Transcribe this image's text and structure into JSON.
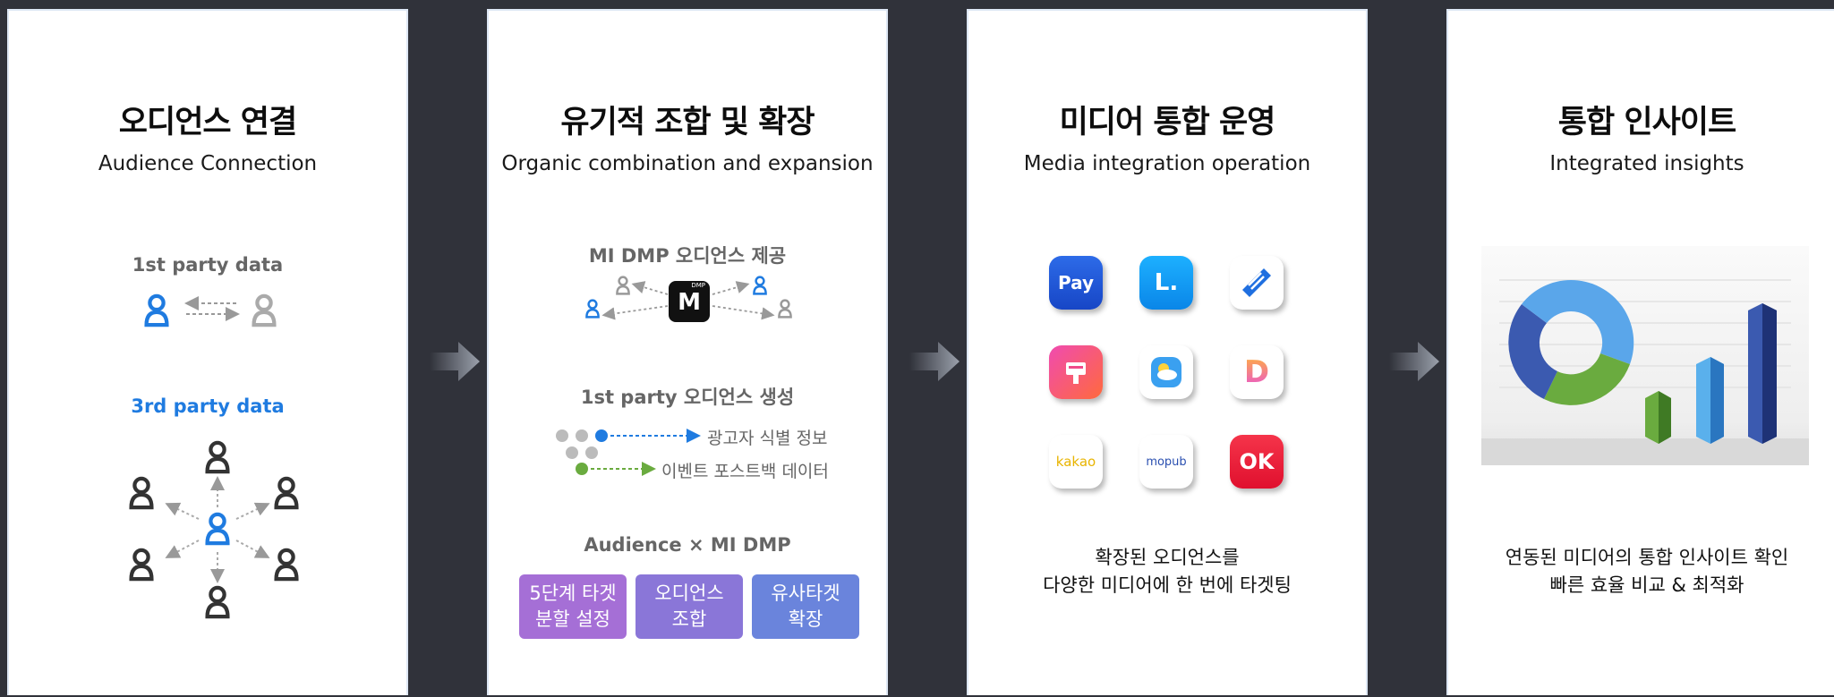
{
  "panels": [
    {
      "title": "오디언스 연결",
      "subtitle": "Audience Connection",
      "first_party_label": "1st party data",
      "third_party_label": "3rd party data"
    },
    {
      "title": "유기적 조합 및 확장",
      "subtitle": "Organic combination and expansion",
      "dmp_label": "MI DMP 오디언스 제공",
      "dmp_logo_letter": "M",
      "dmp_logo_small": "DMP",
      "generate_label": "1st party 오디언스 생성",
      "flow_1": "광고자 식별 정보",
      "flow_2": "이벤트 포스트백 데이터",
      "combine_label": "Audience × MI DMP",
      "tags": [
        "5단계 타겟\n분할 설정",
        "오디언스\n조합",
        "유사타겟\n확장"
      ],
      "tag_colors": [
        "#a56fd6",
        "#8a76d8",
        "#6a84dc"
      ]
    },
    {
      "title": "미디어 통합 운영",
      "subtitle": "Media integration operation",
      "apps": [
        {
          "icon": "naver-pay-icon",
          "text": "Pay"
        },
        {
          "icon": "line-icon",
          "text": "L."
        },
        {
          "icon": "news-icon",
          "text": ""
        },
        {
          "icon": "marketing-app-icon",
          "text": ""
        },
        {
          "icon": "weather-app-icon",
          "text": ""
        },
        {
          "icon": "d-app-icon",
          "text": "D"
        },
        {
          "icon": "kakao-icon",
          "text": "kakao"
        },
        {
          "icon": "mopub-icon",
          "text": "mopub"
        },
        {
          "icon": "ok-cashbag-icon",
          "text": "OK"
        }
      ],
      "caption": "확장된 오디언스를\n다양한 미디어에 한 번에 타겟팅"
    },
    {
      "title": "통합 인사이트",
      "subtitle": "Integrated insights",
      "caption": "연동된 미디어의 통합 인사이트 확인\n빠른 효율 비교 & 최적화"
    }
  ],
  "colors": {
    "background": "#30323a",
    "accent_blue": "#1f7be0",
    "gray_person": "#aaaaaa",
    "dark_person": "#333333",
    "green": "#6aab3f"
  }
}
